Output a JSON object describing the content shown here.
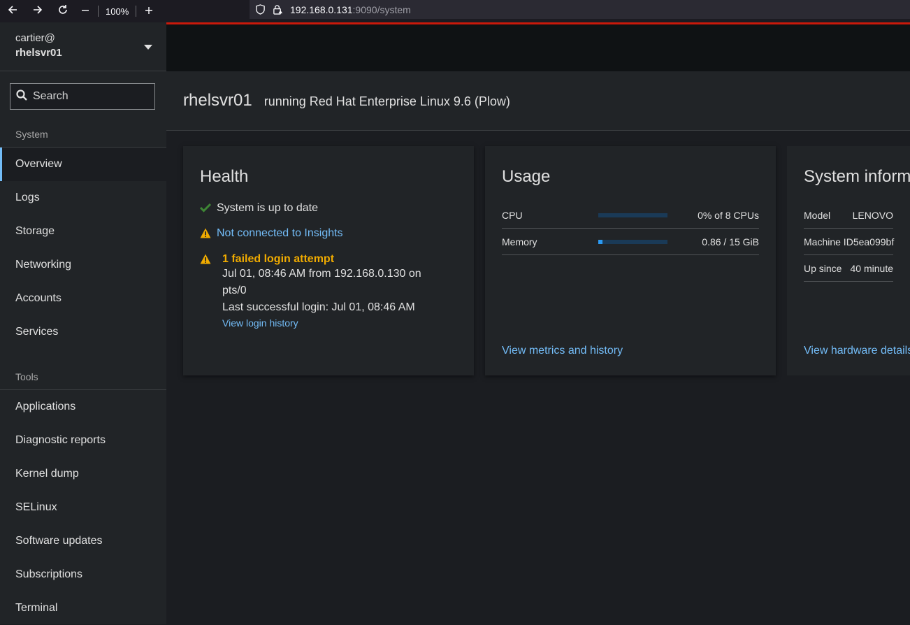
{
  "browser": {
    "zoom": "100%",
    "url_host": "192.168.0.131",
    "url_path": ":9090/system"
  },
  "sidebar": {
    "user": "cartier@",
    "host": "rhelsvr01",
    "search_placeholder": "Search",
    "system_label": "System",
    "system_items": [
      "Overview",
      "Logs",
      "Storage",
      "Networking",
      "Accounts",
      "Services"
    ],
    "tools_label": "Tools",
    "tools_items": [
      "Applications",
      "Diagnostic reports",
      "Kernel dump",
      "SELinux",
      "Software updates",
      "Subscriptions",
      "Terminal"
    ]
  },
  "header": {
    "title": "rhelsvr01",
    "subtitle": "running Red Hat Enterprise Linux 9.6 (Plow)"
  },
  "health": {
    "title": "Health",
    "up_to_date": "System is up to date",
    "insights": "Not connected to Insights",
    "failed_login": "1 failed login attempt",
    "failed_detail": "Jul 01, 08:46 AM from 192.168.0.130 on pts/0",
    "last_success": "Last successful login: Jul 01, 08:46 AM",
    "history_link": "View login history",
    "ok_color": "#3e8635",
    "warn_color": "#f0ab00"
  },
  "usage": {
    "title": "Usage",
    "cpu_label": "CPU",
    "cpu_value": "0% of 8 CPUs",
    "cpu_fraction": 0.0,
    "memory_label": "Memory",
    "memory_value": "0.86 / 15 GiB",
    "memory_fraction": 0.057,
    "link": "View metrics and history"
  },
  "sysinfo": {
    "title": "System inform",
    "rows": [
      {
        "key": "Model",
        "value": "LENOVO"
      },
      {
        "key": "Machine ID",
        "value": "5ea099bf"
      },
      {
        "key": "Up since",
        "value": "40 minute"
      }
    ],
    "link": "View hardware details"
  }
}
